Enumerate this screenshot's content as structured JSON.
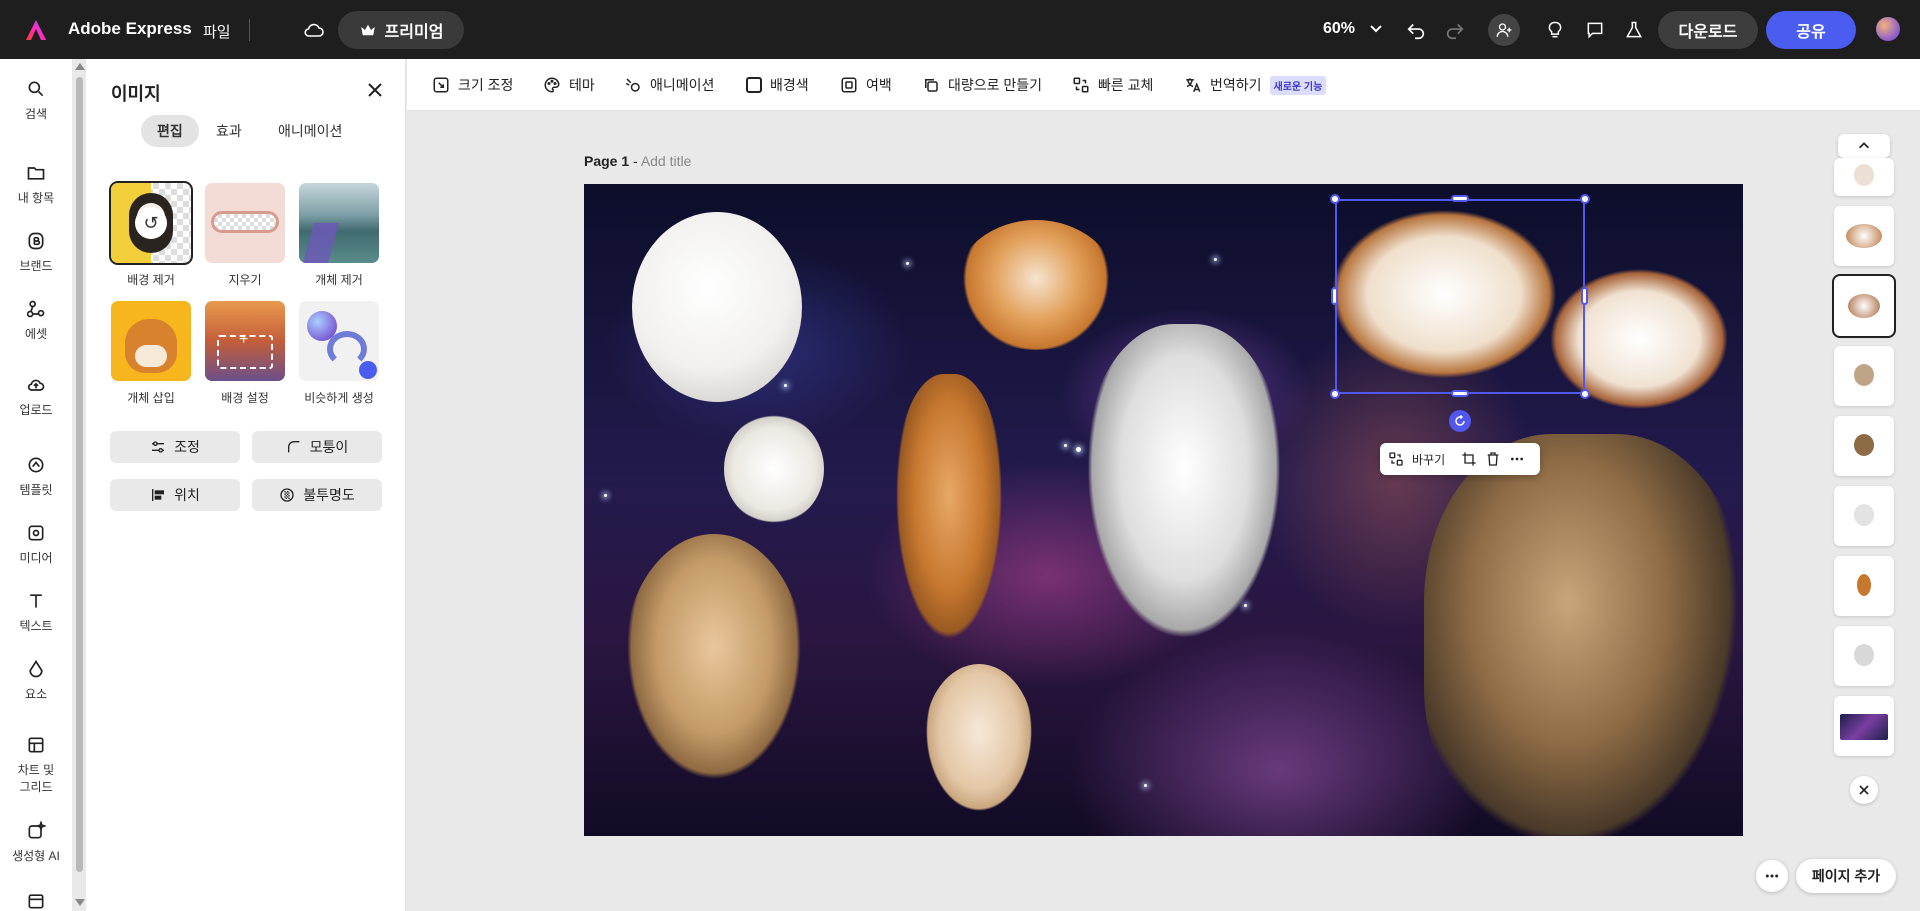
{
  "header": {
    "app_name": "Adobe Express",
    "file_menu": "파일",
    "premium_label": "프리미엄",
    "zoom": "60%",
    "download_label": "다운로드",
    "share_label": "공유"
  },
  "rail": {
    "items": [
      {
        "label": "검색",
        "icon": "search-icon"
      },
      {
        "label": "내 항목",
        "icon": "folder-icon"
      },
      {
        "label": "브랜드",
        "icon": "brand-icon"
      },
      {
        "label": "에셋",
        "icon": "assets-icon"
      },
      {
        "label": "업로드",
        "icon": "upload-icon"
      },
      {
        "label": "템플릿",
        "icon": "templates-icon"
      },
      {
        "label": "미디어",
        "icon": "media-icon"
      },
      {
        "label": "텍스트",
        "icon": "text-icon"
      },
      {
        "label": "요소",
        "icon": "elements-icon"
      },
      {
        "label": "차트 및",
        "label2": "그리드",
        "icon": "charts-icon"
      },
      {
        "label": "생성형 AI",
        "icon": "generative-ai-icon"
      }
    ]
  },
  "panel": {
    "title": "이미지",
    "tabs": [
      "편집",
      "효과",
      "애니메이션"
    ],
    "tools": [
      "배경 제거",
      "지우기",
      "개체 제거",
      "개체 삽입",
      "배경 설정",
      "비슷하게 생성"
    ],
    "buttons": [
      "조정",
      "모퉁이",
      "위치",
      "불투명도"
    ]
  },
  "toolbar": {
    "items": [
      "크기 조정",
      "테마",
      "애니메이션",
      "배경색",
      "여백",
      "대량으로 만들기",
      "빠른 교체",
      "번역하기"
    ],
    "new_badge": "새로운 기능"
  },
  "canvas": {
    "page_label": "Page 1",
    "page_separator": " - ",
    "add_title": "Add title",
    "float_toolbar_label": "바꾸기"
  },
  "footer": {
    "add_page": "페이지 추가"
  },
  "colors": {
    "accent": "#4b5cf0",
    "topbar": "#1e1e1e",
    "selection": "#5058f0"
  }
}
